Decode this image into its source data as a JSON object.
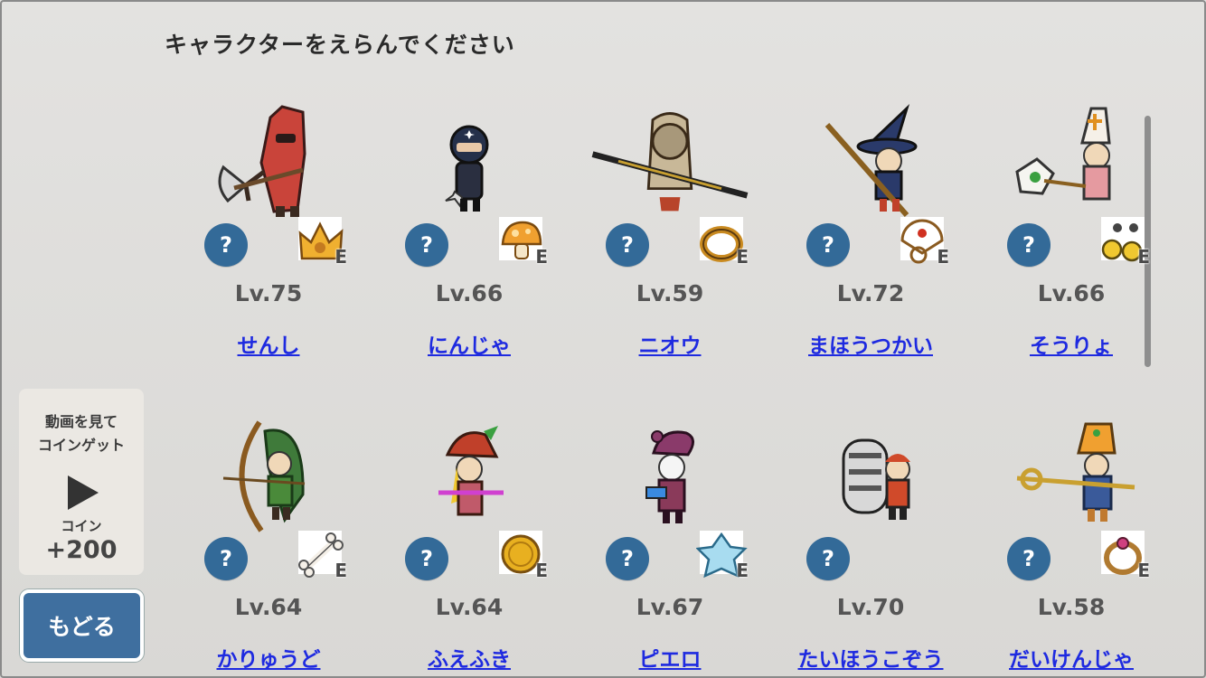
{
  "screen": {
    "title": "キャラクターをえらんでください",
    "back_label": "もどる"
  },
  "coin_panel": {
    "watch_line1": "動画を見て",
    "watch_line2": "コインゲット",
    "coin_label": "コイン",
    "amount": "+200"
  },
  "colors": {
    "accent_blue": "#336a98",
    "link_blue": "#1e2ae0",
    "back_button": "#3f6f9f"
  },
  "characters": [
    {
      "name": "せんし",
      "level": "Lv.75",
      "equip_icon": "crown-icon",
      "equip_badge": "E",
      "sprite": "warrior-icon"
    },
    {
      "name": "にんじゃ",
      "level": "Lv.66",
      "equip_icon": "mushroom-icon",
      "equip_badge": "E",
      "sprite": "ninja-icon"
    },
    {
      "name": "ニオウ",
      "level": "Lv.59",
      "equip_icon": "bracelet-icon",
      "equip_badge": "E",
      "sprite": "nio-icon"
    },
    {
      "name": "まほうつかい",
      "level": "Lv.72",
      "equip_icon": "fan-icon",
      "equip_badge": "E",
      "sprite": "wizard-icon"
    },
    {
      "name": "そうりょ",
      "level": "Lv.66",
      "equip_icon": "earrings-icon",
      "equip_badge": "E",
      "sprite": "priest-icon"
    },
    {
      "name": "かりゅうど",
      "level": "Lv.64",
      "equip_icon": "bone-icon",
      "equip_badge": "E",
      "sprite": "hunter-icon"
    },
    {
      "name": "ふえふき",
      "level": "Lv.64",
      "equip_icon": "gold-coin-icon",
      "equip_badge": "E",
      "sprite": "flutist-icon"
    },
    {
      "name": "ピエロ",
      "level": "Lv.67",
      "equip_icon": "ice-crystal-icon",
      "equip_badge": "E",
      "sprite": "clown-icon"
    },
    {
      "name": "たいほうこぞう",
      "level": "Lv.70",
      "equip_icon": "",
      "equip_badge": "",
      "sprite": "cannon-kid-icon"
    },
    {
      "name": "だいけんじゃ",
      "level": "Lv.58",
      "equip_icon": "ring-icon",
      "equip_badge": "E",
      "sprite": "sage-icon"
    }
  ]
}
